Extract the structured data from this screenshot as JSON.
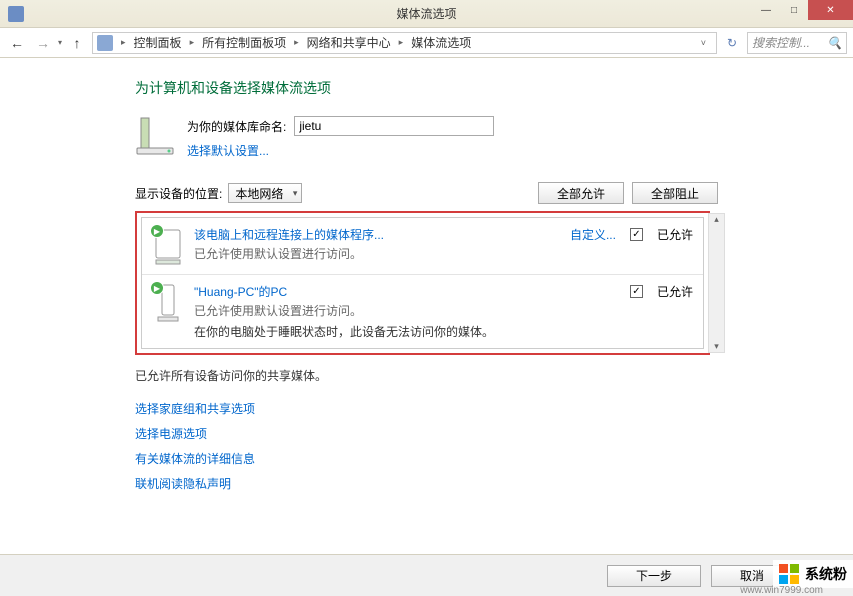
{
  "window": {
    "title": "媒体流选项"
  },
  "breadcrumb": {
    "items": [
      "控制面板",
      "所有控制面板项",
      "网络和共享中心",
      "媒体流选项"
    ]
  },
  "search": {
    "placeholder": "搜索控制..."
  },
  "page": {
    "title": "为计算机和设备选择媒体流选项",
    "library_label": "为你的媒体库命名:",
    "library_value": "jietu",
    "default_settings_link": "选择默认设置...",
    "location_label": "显示设备的位置:",
    "location_value": "本地网络",
    "allow_all": "全部允许",
    "block_all": "全部阻止"
  },
  "devices": [
    {
      "title": "该电脑上和远程连接上的媒体程序...",
      "subtitle": "已允许使用默认设置进行访问。",
      "note": "",
      "customize": "自定义...",
      "allowed_label": "已允许",
      "checked": true
    },
    {
      "title": "\"Huang-PC\"的PC",
      "subtitle": "已允许使用默认设置进行访问。",
      "note": "在你的电脑处于睡眠状态时，此设备无法访问你的媒体。",
      "customize": "",
      "allowed_label": "已允许",
      "checked": true
    }
  ],
  "status": "已允许所有设备访问你的共享媒体。",
  "links": [
    "选择家庭组和共享选项",
    "选择电源选项",
    "有关媒体流的详细信息",
    "联机阅读隐私声明"
  ],
  "footer": {
    "next": "下一步",
    "cancel": "取消"
  },
  "watermark": {
    "text": "系统粉",
    "url": "www.win7999.com"
  }
}
